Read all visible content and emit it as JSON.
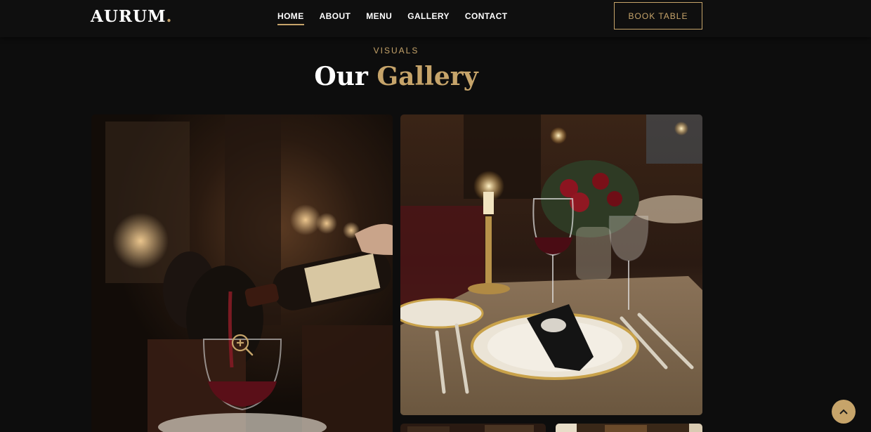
{
  "brand": {
    "name": "AURUM",
    "dot": "."
  },
  "nav": {
    "items": [
      {
        "label": "HOME",
        "active": true
      },
      {
        "label": "ABOUT",
        "active": false
      },
      {
        "label": "MENU",
        "active": false
      },
      {
        "label": "GALLERY",
        "active": false
      },
      {
        "label": "CONTACT",
        "active": false
      }
    ],
    "cta_label": "BOOK TABLE"
  },
  "gallery": {
    "eyebrow": "VISUALS",
    "title_main": "Our",
    "title_accent": "Gallery",
    "images": [
      {
        "subject": "wine-pour"
      },
      {
        "subject": "candlelit-table-setting"
      },
      {
        "subject": "dining-room-partial"
      },
      {
        "subject": "dining-room-partial"
      }
    ]
  },
  "colors": {
    "accent": "#c6a46a",
    "background": "#0d0d0d",
    "header": "#0f0f0f"
  },
  "icons": {
    "zoom": "zoom-in-icon",
    "back_to_top": "chevron-up-icon"
  }
}
